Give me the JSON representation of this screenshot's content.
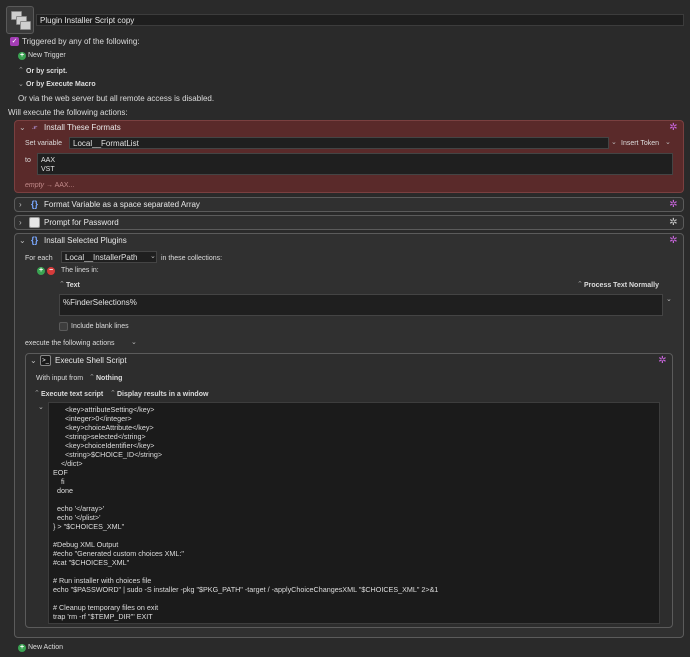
{
  "macro": {
    "name": "Plugin Installer Script copy"
  },
  "triggers": {
    "heading": "Triggered by any of the following:",
    "new_trigger": "New Trigger",
    "by_script": "Or by script.",
    "by_execute_macro": "Or by Execute Macro",
    "web_server": "Or via the web server but all remote access is disabled."
  },
  "actions_heading": "Will execute the following actions:",
  "action1": {
    "title": "Install These Formats",
    "set_variable_label": "Set variable",
    "variable_name": "Local__FormatList",
    "insert_token": "Insert Token",
    "to_label": "to",
    "value_lines": [
      "AAX",
      "VST"
    ],
    "empty_hint": "empty",
    "empty_arrow_hint": "AAX..."
  },
  "action2": {
    "title": "Format Variable as a space separated Array"
  },
  "action3": {
    "title": "Prompt for Password"
  },
  "action4": {
    "title": "Install Selected Plugins",
    "for_each_label": "For each",
    "variable_name": "Local__InstallerPath",
    "in_collections": "in these collections:",
    "lines_in": "The lines in:",
    "text_label": "Text",
    "process_text": "Process Text Normally",
    "text_value": "%FinderSelections%",
    "include_blank": "Include blank lines",
    "execute_following": "execute the following actions"
  },
  "shell": {
    "title": "Execute Shell Script",
    "with_input_from": "With input from",
    "input_value": "Nothing",
    "execute_mode": "Execute text script",
    "display_mode": "Display results in a window",
    "script": "      <key>attributeSetting</key>\n      <integer>0</integer>\n      <key>choiceAttribute</key>\n      <string>selected</string>\n      <key>choiceIdentifier</key>\n      <string>$CHOICE_ID</string>\n    </dict>\nEOF\n    fi\n  done\n\n  echo '</array>'\n  echo '</plist>'\n} > \"$CHOICES_XML\"\n\n#Debug XML Output\n#echo \"Generated custom choices XML:\"\n#cat \"$CHOICES_XML\"\n\n# Run installer with choices file\necho \"$PASSWORD\" | sudo -S installer -pkg \"$PKG_PATH\" -target / -applyChoiceChangesXML \"$CHOICES_XML\" 2>&1\n\n# Cleanup temporary files on exit\ntrap 'rm -rf \"$TEMP_DIR\"' EXIT"
  },
  "new_action": "New Action",
  "colors": {
    "accent_purple": "#a33db5",
    "red_action_bg": "#5a2a2a",
    "green": "#3aa352",
    "red": "#d53b3b"
  },
  "icons": {
    "gear": "gear-icon",
    "disclosure": "chevron-icon",
    "variable": "variable-x-icon",
    "braces": "braces-icon",
    "window": "window-icon",
    "terminal": "terminal-icon"
  }
}
